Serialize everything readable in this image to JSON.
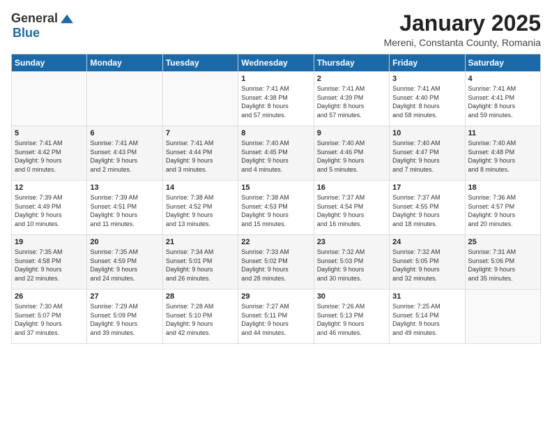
{
  "header": {
    "logo_general": "General",
    "logo_blue": "Blue",
    "month_title": "January 2025",
    "subtitle": "Mereni, Constanta County, Romania"
  },
  "weekdays": [
    "Sunday",
    "Monday",
    "Tuesday",
    "Wednesday",
    "Thursday",
    "Friday",
    "Saturday"
  ],
  "weeks": [
    [
      {
        "day": "",
        "info": ""
      },
      {
        "day": "",
        "info": ""
      },
      {
        "day": "",
        "info": ""
      },
      {
        "day": "1",
        "info": "Sunrise: 7:41 AM\nSunset: 4:38 PM\nDaylight: 8 hours\nand 57 minutes."
      },
      {
        "day": "2",
        "info": "Sunrise: 7:41 AM\nSunset: 4:39 PM\nDaylight: 8 hours\nand 57 minutes."
      },
      {
        "day": "3",
        "info": "Sunrise: 7:41 AM\nSunset: 4:40 PM\nDaylight: 8 hours\nand 58 minutes."
      },
      {
        "day": "4",
        "info": "Sunrise: 7:41 AM\nSunset: 4:41 PM\nDaylight: 8 hours\nand 59 minutes."
      }
    ],
    [
      {
        "day": "5",
        "info": "Sunrise: 7:41 AM\nSunset: 4:42 PM\nDaylight: 9 hours\nand 0 minutes."
      },
      {
        "day": "6",
        "info": "Sunrise: 7:41 AM\nSunset: 4:43 PM\nDaylight: 9 hours\nand 2 minutes."
      },
      {
        "day": "7",
        "info": "Sunrise: 7:41 AM\nSunset: 4:44 PM\nDaylight: 9 hours\nand 3 minutes."
      },
      {
        "day": "8",
        "info": "Sunrise: 7:40 AM\nSunset: 4:45 PM\nDaylight: 9 hours\nand 4 minutes."
      },
      {
        "day": "9",
        "info": "Sunrise: 7:40 AM\nSunset: 4:46 PM\nDaylight: 9 hours\nand 5 minutes."
      },
      {
        "day": "10",
        "info": "Sunrise: 7:40 AM\nSunset: 4:47 PM\nDaylight: 9 hours\nand 7 minutes."
      },
      {
        "day": "11",
        "info": "Sunrise: 7:40 AM\nSunset: 4:48 PM\nDaylight: 9 hours\nand 8 minutes."
      }
    ],
    [
      {
        "day": "12",
        "info": "Sunrise: 7:39 AM\nSunset: 4:49 PM\nDaylight: 9 hours\nand 10 minutes."
      },
      {
        "day": "13",
        "info": "Sunrise: 7:39 AM\nSunset: 4:51 PM\nDaylight: 9 hours\nand 11 minutes."
      },
      {
        "day": "14",
        "info": "Sunrise: 7:38 AM\nSunset: 4:52 PM\nDaylight: 9 hours\nand 13 minutes."
      },
      {
        "day": "15",
        "info": "Sunrise: 7:38 AM\nSunset: 4:53 PM\nDaylight: 9 hours\nand 15 minutes."
      },
      {
        "day": "16",
        "info": "Sunrise: 7:37 AM\nSunset: 4:54 PM\nDaylight: 9 hours\nand 16 minutes."
      },
      {
        "day": "17",
        "info": "Sunrise: 7:37 AM\nSunset: 4:55 PM\nDaylight: 9 hours\nand 18 minutes."
      },
      {
        "day": "18",
        "info": "Sunrise: 7:36 AM\nSunset: 4:57 PM\nDaylight: 9 hours\nand 20 minutes."
      }
    ],
    [
      {
        "day": "19",
        "info": "Sunrise: 7:35 AM\nSunset: 4:58 PM\nDaylight: 9 hours\nand 22 minutes."
      },
      {
        "day": "20",
        "info": "Sunrise: 7:35 AM\nSunset: 4:59 PM\nDaylight: 9 hours\nand 24 minutes."
      },
      {
        "day": "21",
        "info": "Sunrise: 7:34 AM\nSunset: 5:01 PM\nDaylight: 9 hours\nand 26 minutes."
      },
      {
        "day": "22",
        "info": "Sunrise: 7:33 AM\nSunset: 5:02 PM\nDaylight: 9 hours\nand 28 minutes."
      },
      {
        "day": "23",
        "info": "Sunrise: 7:32 AM\nSunset: 5:03 PM\nDaylight: 9 hours\nand 30 minutes."
      },
      {
        "day": "24",
        "info": "Sunrise: 7:32 AM\nSunset: 5:05 PM\nDaylight: 9 hours\nand 32 minutes."
      },
      {
        "day": "25",
        "info": "Sunrise: 7:31 AM\nSunset: 5:06 PM\nDaylight: 9 hours\nand 35 minutes."
      }
    ],
    [
      {
        "day": "26",
        "info": "Sunrise: 7:30 AM\nSunset: 5:07 PM\nDaylight: 9 hours\nand 37 minutes."
      },
      {
        "day": "27",
        "info": "Sunrise: 7:29 AM\nSunset: 5:09 PM\nDaylight: 9 hours\nand 39 minutes."
      },
      {
        "day": "28",
        "info": "Sunrise: 7:28 AM\nSunset: 5:10 PM\nDaylight: 9 hours\nand 42 minutes."
      },
      {
        "day": "29",
        "info": "Sunrise: 7:27 AM\nSunset: 5:11 PM\nDaylight: 9 hours\nand 44 minutes."
      },
      {
        "day": "30",
        "info": "Sunrise: 7:26 AM\nSunset: 5:13 PM\nDaylight: 9 hours\nand 46 minutes."
      },
      {
        "day": "31",
        "info": "Sunrise: 7:25 AM\nSunset: 5:14 PM\nDaylight: 9 hours\nand 49 minutes."
      },
      {
        "day": "",
        "info": ""
      }
    ]
  ]
}
